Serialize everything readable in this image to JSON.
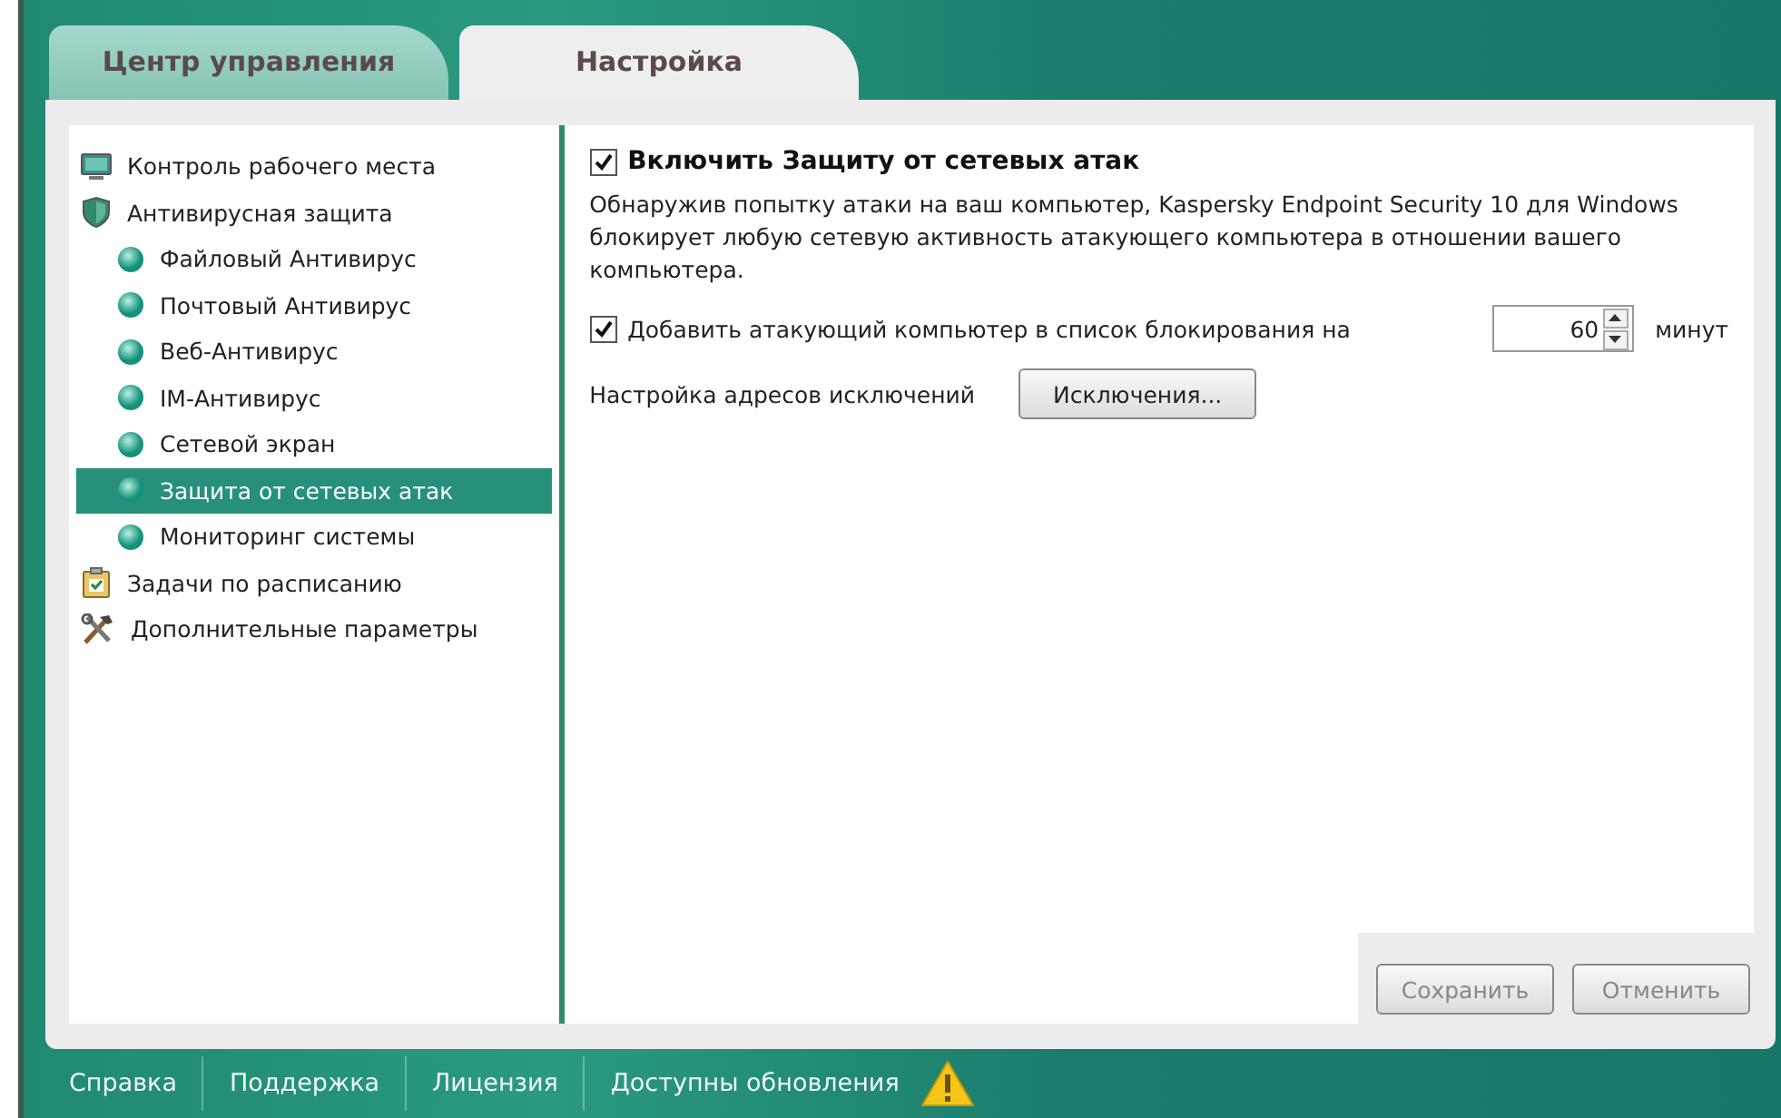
{
  "tabs": [
    {
      "label": "Центр управления",
      "selected": false
    },
    {
      "label": "Настройка",
      "selected": true
    }
  ],
  "sidebar": {
    "items": [
      {
        "label": "Контроль рабочего места",
        "kind": "monitor",
        "selected": false
      },
      {
        "label": "Антивирусная защита",
        "kind": "shield",
        "selected": false,
        "children": [
          {
            "label": "Файловый Антивирус",
            "kind": "dot",
            "selected": false
          },
          {
            "label": "Почтовый Антивирус",
            "kind": "dot",
            "selected": false
          },
          {
            "label": "Веб-Антивирус",
            "kind": "dot",
            "selected": false
          },
          {
            "label": "IM-Антивирус",
            "kind": "dot",
            "selected": false
          },
          {
            "label": "Сетевой экран",
            "kind": "dot",
            "selected": false
          },
          {
            "label": "Защита от сетевых атак",
            "kind": "dot",
            "selected": true
          },
          {
            "label": "Мониторинг системы",
            "kind": "dot",
            "selected": false
          }
        ]
      },
      {
        "label": "Задачи по расписанию",
        "kind": "clipboard",
        "selected": false
      },
      {
        "label": "Дополнительные параметры",
        "kind": "tools",
        "selected": false
      }
    ]
  },
  "settings": {
    "enable": {
      "label": "Включить Защиту от сетевых атак",
      "checked": true
    },
    "description": "Обнаружив попытку атаки на ваш компьютер, Kaspersky Endpoint Security 10 для Windows блокирует любую сетевую активность атакующего компьютера в отношении вашего компьютера.",
    "block": {
      "label": "Добавить атакующий компьютер в список блокирования на",
      "checked": true,
      "value": "60",
      "unit": "минут"
    },
    "exclusions": {
      "label": "Настройка адресов исключений",
      "button": "Исключения..."
    }
  },
  "buttons": [
    {
      "label": "Сохранить",
      "disabled": true
    },
    {
      "label": "Отменить",
      "disabled": true
    }
  ],
  "footer": {
    "links": [
      "Справка",
      "Поддержка",
      "Лицензия",
      "Доступны обновления"
    ],
    "warning": true
  }
}
